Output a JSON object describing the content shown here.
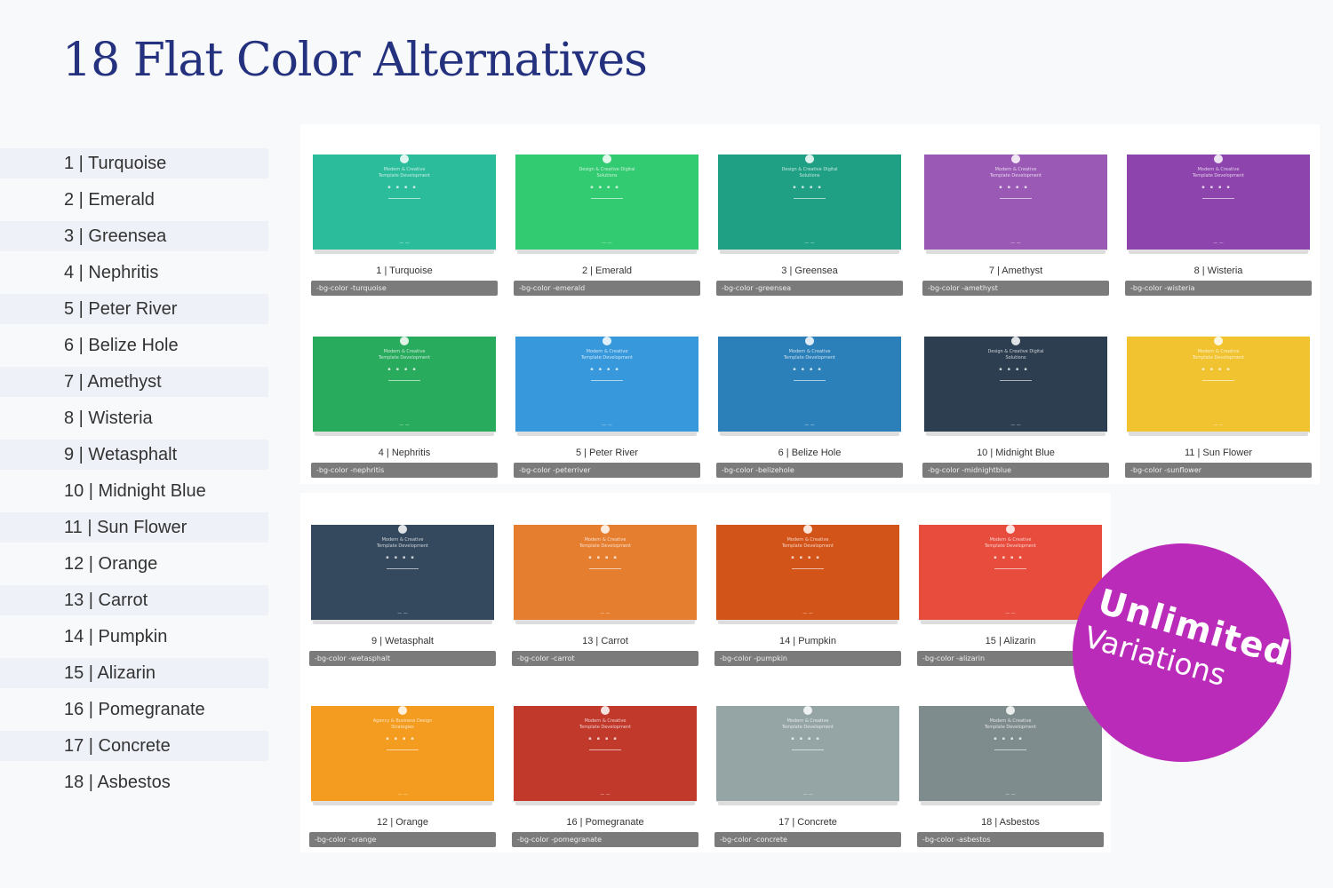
{
  "title": "18 Flat Color Alternatives",
  "list": [
    "1 | Turquoise",
    "2 | Emerald",
    "3 | Greensea",
    "4 | Nephritis",
    "5 | Peter River",
    "6 | Belize Hole",
    "7 | Amethyst",
    "8 | Wisteria",
    "9 | Wetasphalt",
    "10 | Midnight Blue",
    "11 | Sun Flower",
    "12 | Orange",
    "13 | Carrot",
    "14 | Pumpkin",
    "15 | Alizarin",
    "16 | Pomegranate",
    "17 | Concrete",
    "18 | Asbestos"
  ],
  "cards": [
    {
      "caption": "1 | Turquoise",
      "class": "-bg-color -turquoise",
      "color": "#2bbc9b",
      "headline": "Modern & Creative Template Development"
    },
    {
      "caption": "2 | Emerald",
      "class": "-bg-color -emerald",
      "color": "#33cb71",
      "headline": "Design & Creative Digital Solutions"
    },
    {
      "caption": "3 | Greensea",
      "class": "-bg-color -greensea",
      "color": "#1fa084",
      "headline": "Design & Creative Digital Solutions"
    },
    {
      "caption": "7 | Amethyst",
      "class": "-bg-color -amethyst",
      "color": "#9b59b6",
      "headline": "Modern & Creative Template Development"
    },
    {
      "caption": "8 | Wisteria",
      "class": "-bg-color -wisteria",
      "color": "#8e44ad",
      "headline": "Modern & Creative Template Development"
    },
    {
      "caption": "4 | Nephritis",
      "class": "-bg-color -nephritis",
      "color": "#29ab5e",
      "headline": "Modern & Creative Template Development"
    },
    {
      "caption": "5 | Peter River",
      "class": "-bg-color -peterriver",
      "color": "#3799dc",
      "headline": "Modern & Creative Template Development"
    },
    {
      "caption": "6 | Belize Hole",
      "class": "-bg-color -belizehole",
      "color": "#2c80ba",
      "headline": "Modern & Creative Template Development"
    },
    {
      "caption": "10 | Midnight Blue",
      "class": "-bg-color -midnightblue",
      "color": "#2c3e50",
      "headline": "Design & Creative Digital Solutions"
    },
    {
      "caption": "11 | Sun Flower",
      "class": "-bg-color -sunflower",
      "color": "#f1c331",
      "headline": "Modern & Creative Template Development"
    },
    {
      "caption": "9 | Wetasphalt",
      "class": "-bg-color -wetasphalt",
      "color": "#34495e",
      "headline": "Modern & Creative Template Development"
    },
    {
      "caption": "13 | Carrot",
      "class": "-bg-color -carrot",
      "color": "#e67e30",
      "headline": "Modern & Creative Template Development"
    },
    {
      "caption": "14 | Pumpkin",
      "class": "-bg-color -pumpkin",
      "color": "#d35418",
      "headline": "Modern & Creative Template Development"
    },
    {
      "caption": "15 | Alizarin",
      "class": "-bg-color -alizarin",
      "color": "#e74c3c",
      "headline": "Modern & Creative Template Development"
    },
    {
      "caption": "12 | Orange",
      "class": "-bg-color -orange",
      "color": "#f39c1f",
      "headline": "Agency & Business Design Strategies"
    },
    {
      "caption": "16 | Pomegranate",
      "class": "-bg-color -pomegranate",
      "color": "#c0392b",
      "headline": "Modern & Creative Template Development"
    },
    {
      "caption": "17 | Concrete",
      "class": "-bg-color -concrete",
      "color": "#95a5a6",
      "headline": "Modern & Creative Template Development"
    },
    {
      "caption": "18 | Asbestos",
      "class": "-bg-color -asbestos",
      "color": "#7f8c8d",
      "headline": "Modern & Creative Template Development"
    }
  ],
  "badge": {
    "line1": "Unlimited",
    "line2": "Variations",
    "color": "#b92bb8"
  }
}
